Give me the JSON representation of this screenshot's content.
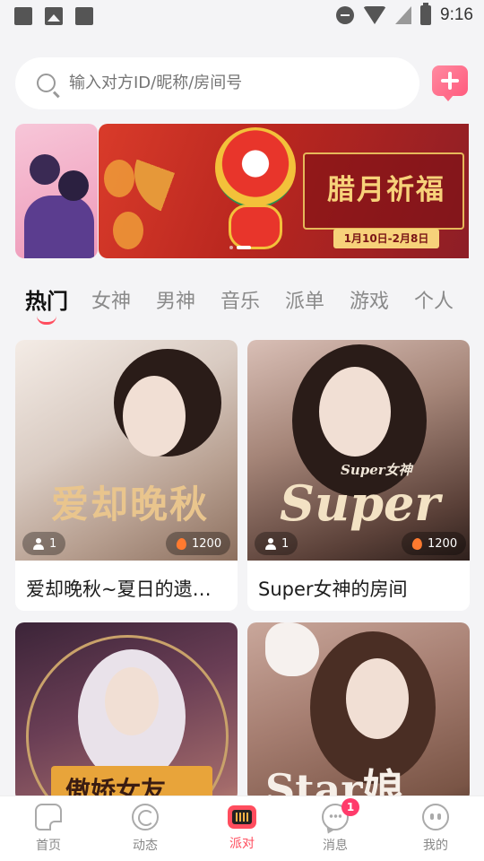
{
  "status_bar": {
    "time": "9:16",
    "left_icons": [
      "square-notification-icon",
      "image-notification-icon",
      "square-notification-icon"
    ],
    "right_icons": [
      "dnd-icon",
      "wifi-icon",
      "no-signal-icon",
      "battery-charging-icon"
    ]
  },
  "search": {
    "placeholder": "输入对方ID/昵称/房间号",
    "icon": "search-icon"
  },
  "add_button": {
    "icon": "plus-icon",
    "color": "#ff6c88"
  },
  "banner": {
    "title": "腊月祈福",
    "date": "1月10日-2月8日",
    "active_index": 1,
    "slides": 2
  },
  "tabs": {
    "items": [
      "热门",
      "女神",
      "男神",
      "音乐",
      "派单",
      "游戏",
      "个人"
    ],
    "active_index": 0
  },
  "rooms": [
    {
      "title": "爱却晚秋~夏日的遗…",
      "watermark": "爱却晚秋",
      "members": "1",
      "heat": "1200"
    },
    {
      "title": "Super女神的房间",
      "watermark": "Super",
      "watermark_small": "Super女神",
      "members": "1",
      "heat": "1200"
    },
    {
      "title": "",
      "watermark": "傲娇女友"
    },
    {
      "title": "",
      "watermark": "Star娘"
    }
  ],
  "bottom_nav": {
    "items": [
      {
        "label": "首页",
        "icon": "home-icon"
      },
      {
        "label": "动态",
        "icon": "dynamic-icon"
      },
      {
        "label": "派对",
        "icon": "party-icon"
      },
      {
        "label": "消息",
        "icon": "message-icon",
        "badge": "1"
      },
      {
        "label": "我的",
        "icon": "profile-icon"
      }
    ],
    "active_index": 2
  },
  "colors": {
    "accent": "#ff4d5e",
    "background": "#f4f4f6",
    "banner_red": "#b8261f",
    "banner_gold": "#f7d27a"
  }
}
